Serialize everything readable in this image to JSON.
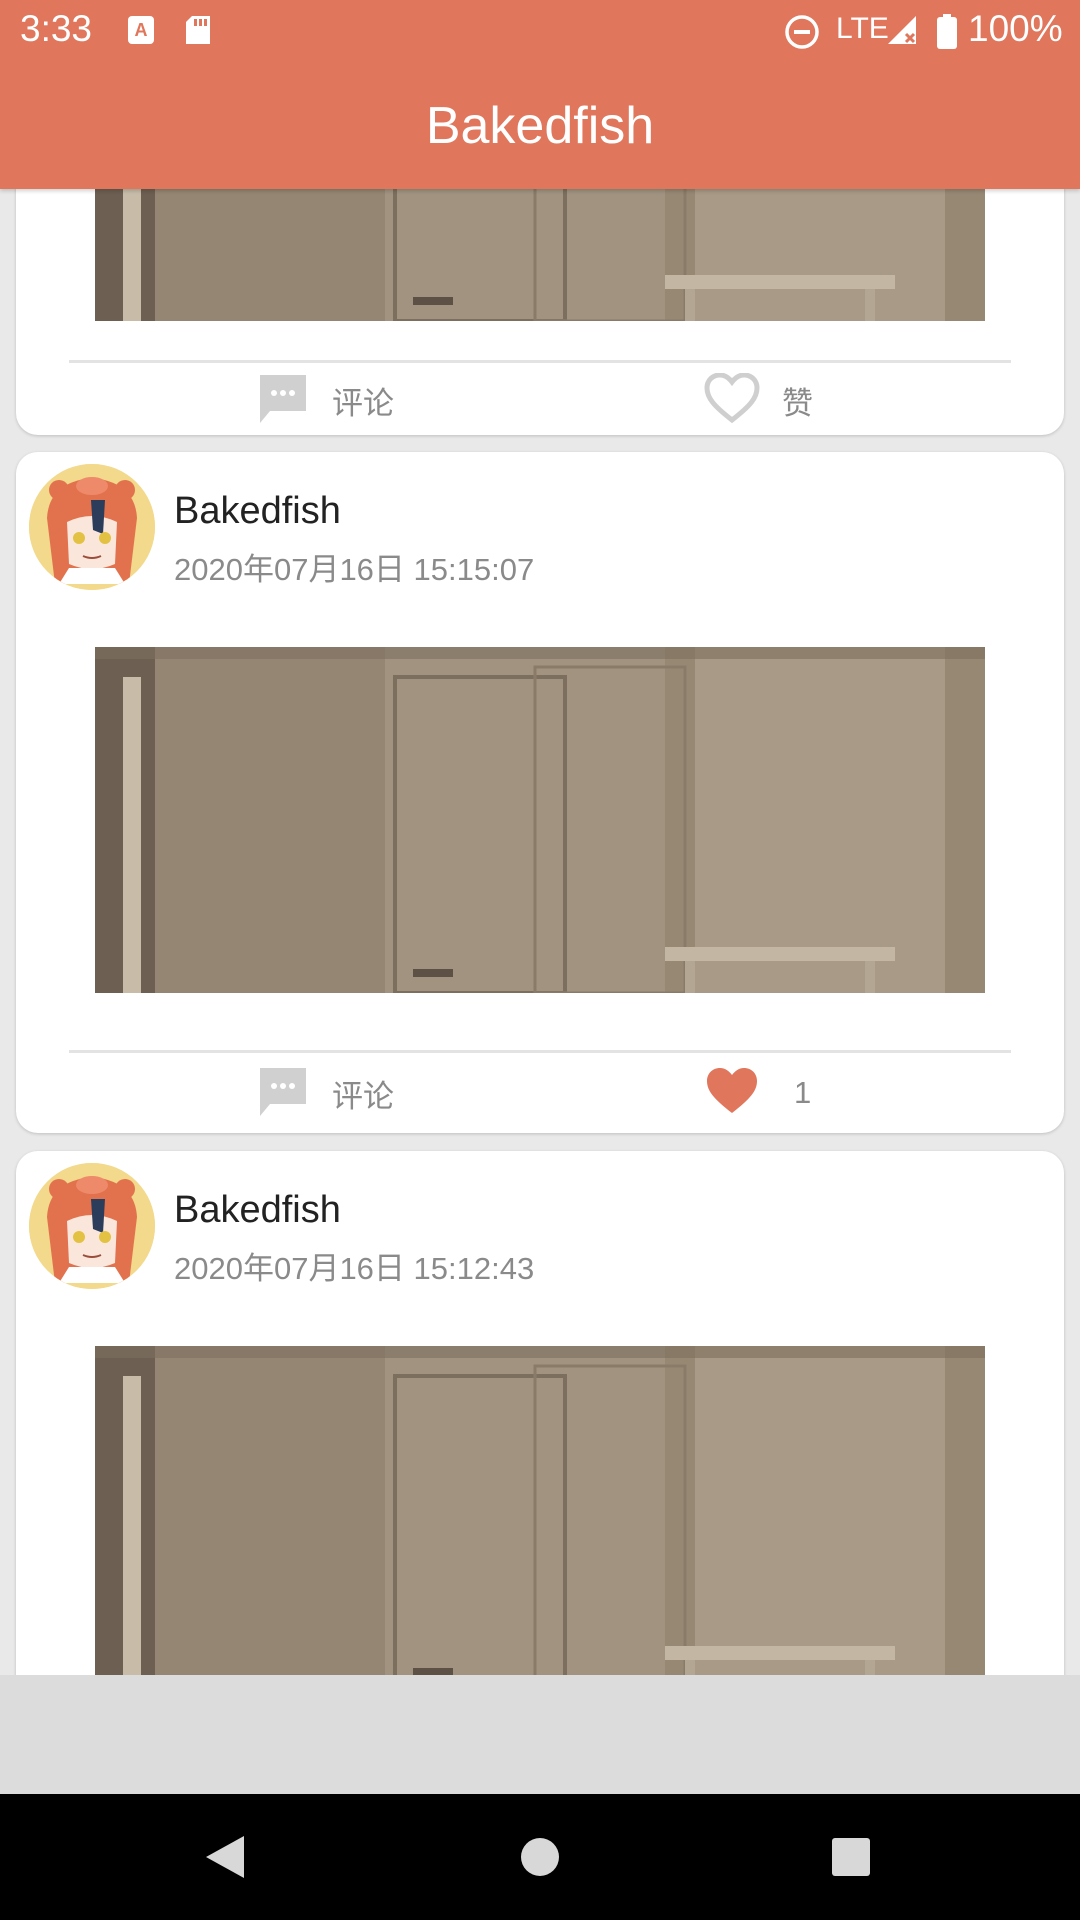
{
  "status_bar": {
    "time": "3:33",
    "network": "LTE",
    "battery": "100%",
    "icons": [
      "text-notification-icon",
      "sd-card-icon",
      "do-not-disturb-icon",
      "signal-icon",
      "battery-icon"
    ]
  },
  "app_bar": {
    "title": "Bakedfish",
    "color": "#e0765c"
  },
  "posts": [
    {
      "author": "",
      "timestamp": "",
      "comment_label": "评论",
      "like_label": "赞",
      "liked": false
    },
    {
      "author": "Bakedfish",
      "timestamp": "2020年07月16日 15:15:07",
      "comment_label": "评论",
      "like_label": "1",
      "liked": true
    },
    {
      "author": "Bakedfish",
      "timestamp": "2020年07月16日 15:12:43"
    }
  ],
  "nav_bar": {
    "icons": [
      "back-icon",
      "home-icon",
      "recents-icon"
    ]
  },
  "colors": {
    "accent": "#e0765c",
    "liked_heart": "#e0765c",
    "muted_text": "#8a8a8a"
  }
}
